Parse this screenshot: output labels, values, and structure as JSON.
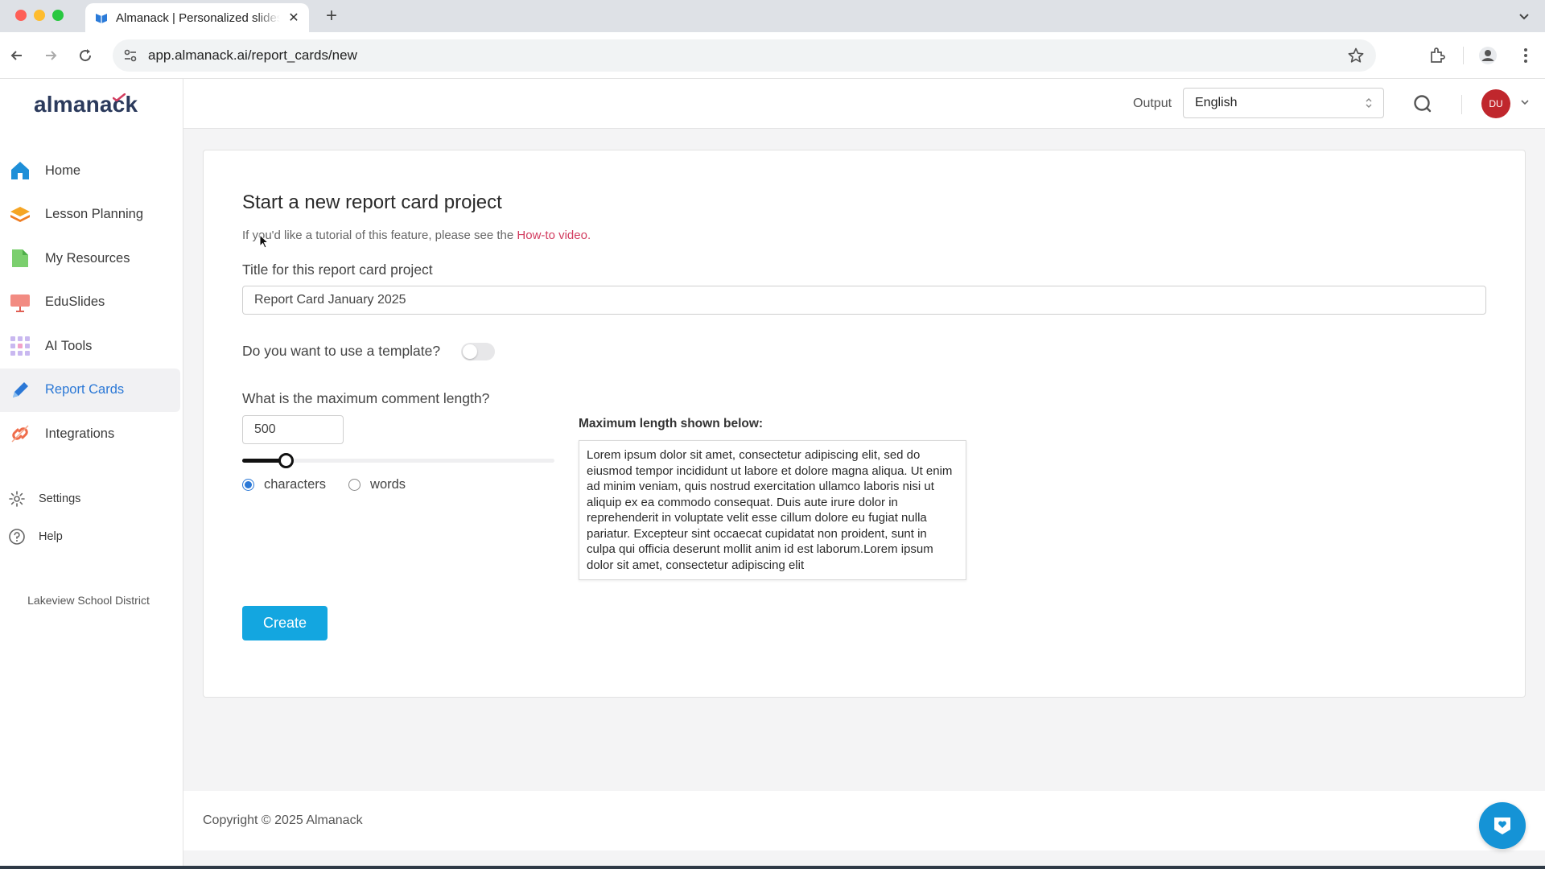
{
  "browser": {
    "tab_title": "Almanack | Personalized slides",
    "url": "app.almanack.ai/report_cards/new"
  },
  "sidebar": {
    "logo": "almanack",
    "items": [
      {
        "label": "Home",
        "icon": "home-icon"
      },
      {
        "label": "Lesson Planning",
        "icon": "layers-icon"
      },
      {
        "label": "My Resources",
        "icon": "document-icon"
      },
      {
        "label": "EduSlides",
        "icon": "presentation-icon"
      },
      {
        "label": "AI Tools",
        "icon": "grid-icon"
      },
      {
        "label": "Report Cards",
        "icon": "pencil-icon",
        "active": true
      },
      {
        "label": "Integrations",
        "icon": "link-icon"
      }
    ],
    "settings_label": "Settings",
    "help_label": "Help",
    "district": "Lakeview School District"
  },
  "header": {
    "output_label": "Output",
    "language": "English",
    "avatar_initials": "DU"
  },
  "form": {
    "page_title": "Start a new report card project",
    "tutorial_text": "If you'd like a tutorial of this feature, please see the ",
    "tutorial_link": "How-to video.",
    "title_label": "Title for this report card project",
    "title_value": "Report Card January 2025",
    "template_label": "Do you want to use a template?",
    "template_enabled": false,
    "max_length_label": "What is the maximum comment length?",
    "max_length_value": "500",
    "slider_fraction": 0.14,
    "unit_characters": "characters",
    "unit_words": "words",
    "selected_unit": "characters",
    "preview_label": "Maximum length shown below:",
    "preview_text": "Lorem ipsum dolor sit amet, consectetur adipiscing elit, sed do eiusmod tempor incididunt ut labore et dolore magna aliqua. Ut enim ad minim veniam, quis nostrud exercitation ullamco laboris nisi ut aliquip ex ea commodo consequat. Duis aute irure dolor in reprehenderit in voluptate velit esse cillum dolore eu fugiat nulla pariatur. Excepteur sint occaecat cupidatat non proident, sunt in culpa qui officia deserunt mollit anim id est laborum.Lorem ipsum dolor sit amet, consectetur adipiscing elit",
    "create_label": "Create"
  },
  "footer": {
    "copyright": "Copyright © 2025 Almanack"
  },
  "colors": {
    "accent": "#2b78d6",
    "create_button": "#13a6e0",
    "link": "#d23c5f",
    "avatar": "#c0272d"
  }
}
